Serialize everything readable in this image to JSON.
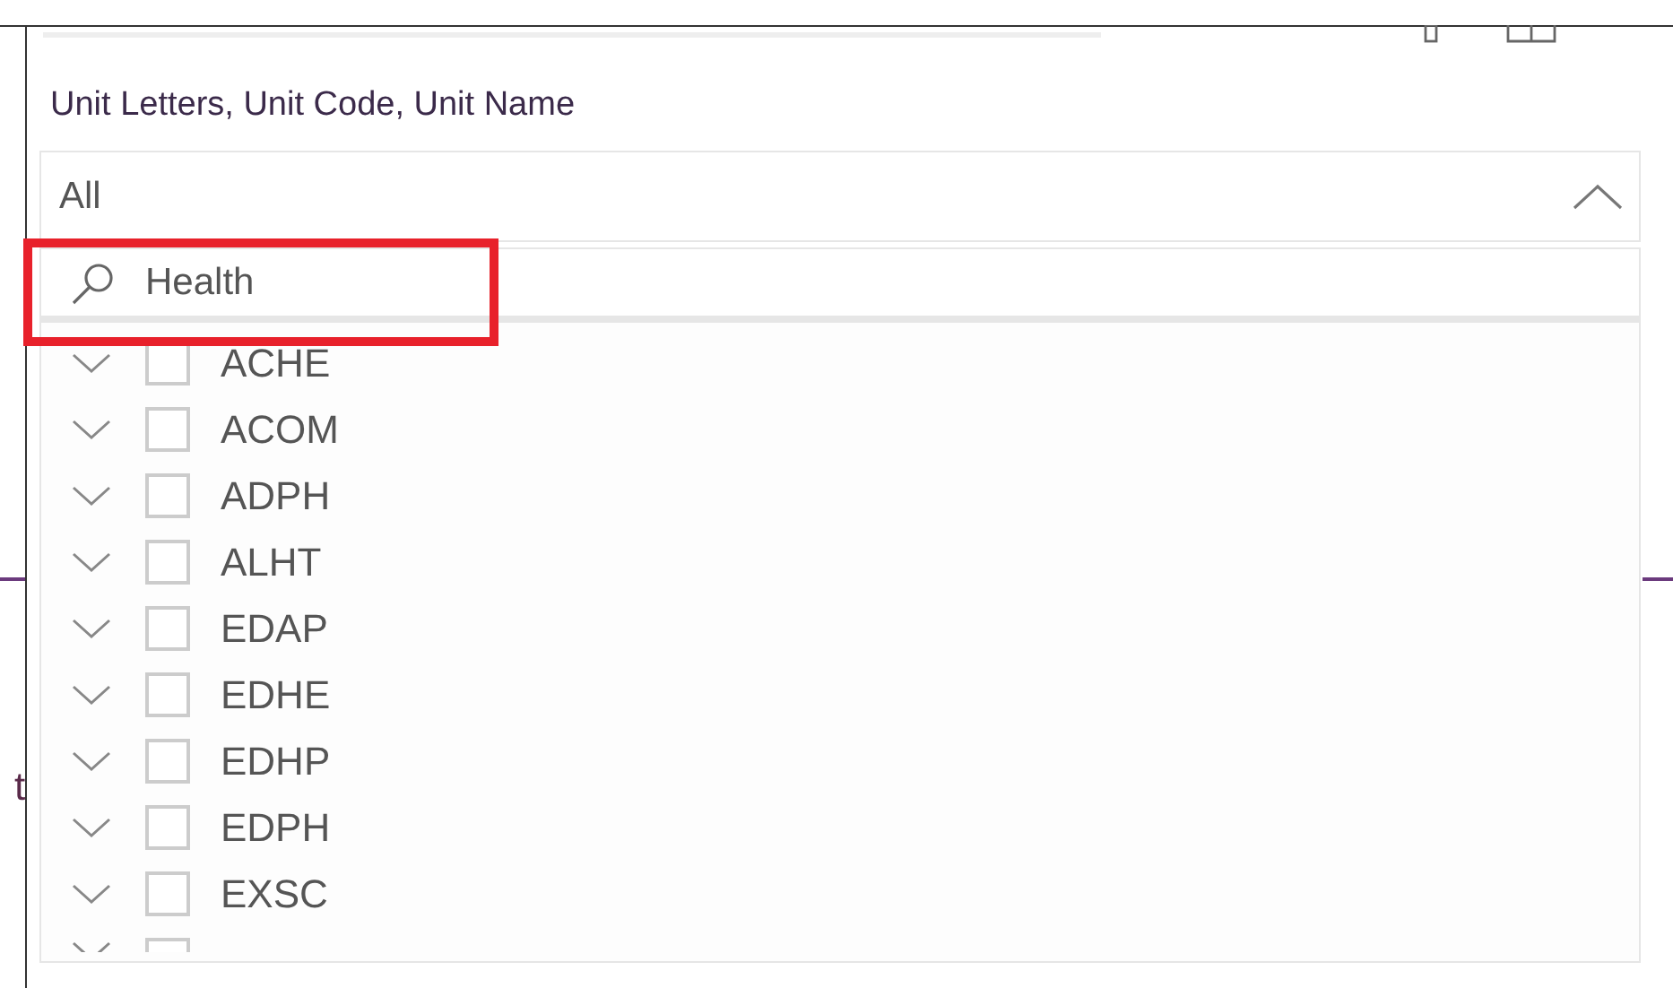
{
  "slicer": {
    "title": "Unit Letters, Unit Code, Unit Name",
    "value": "All",
    "expanded": true,
    "search": {
      "value": "Health",
      "highlighted": true
    },
    "items": [
      {
        "label": "ACHE",
        "checked": false,
        "expanded": false
      },
      {
        "label": "ACOM",
        "checked": false,
        "expanded": false
      },
      {
        "label": "ADPH",
        "checked": false,
        "expanded": false
      },
      {
        "label": "ALHT",
        "checked": false,
        "expanded": false
      },
      {
        "label": "EDAP",
        "checked": false,
        "expanded": false
      },
      {
        "label": "EDHE",
        "checked": false,
        "expanded": false
      },
      {
        "label": "EDHP",
        "checked": false,
        "expanded": false
      },
      {
        "label": "EDPH",
        "checked": false,
        "expanded": false
      },
      {
        "label": "EXSC",
        "checked": false,
        "expanded": false
      },
      {
        "checked": false,
        "expanded": false
      }
    ]
  },
  "background_text": "t"
}
